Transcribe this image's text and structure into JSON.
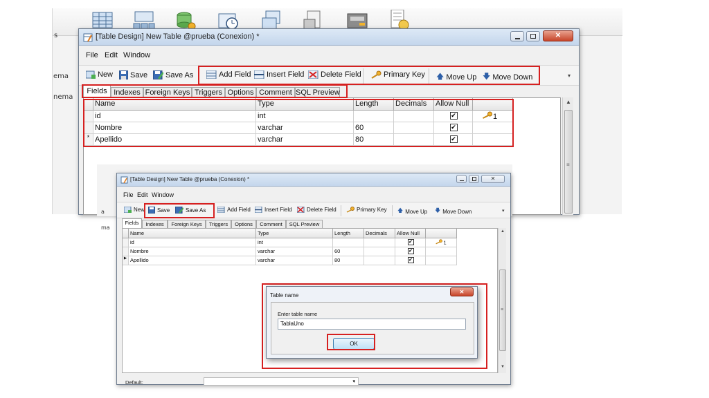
{
  "background": {
    "left_labels": [
      "s",
      "ema",
      "nema"
    ],
    "left_labels_small": [
      "a",
      "ma"
    ]
  },
  "main_window": {
    "title": "[Table Design] New Table @prueba (Conexion) *",
    "menu": {
      "file": "File",
      "edit": "Edit",
      "window": "Window"
    },
    "toolbar": {
      "new": "New",
      "save": "Save",
      "save_as": "Save As",
      "add_field": "Add Field",
      "insert_field": "Insert Field",
      "delete_field": "Delete Field",
      "primary_key": "Primary Key",
      "move_up": "Move Up",
      "move_down": "Move Down"
    },
    "tabs": [
      "Fields",
      "Indexes",
      "Foreign Keys",
      "Triggers",
      "Options",
      "Comment",
      "SQL Preview"
    ],
    "columns": [
      "Name",
      "Type",
      "Length",
      "Decimals",
      "Allow Null",
      ""
    ],
    "rows": [
      {
        "marker": "",
        "name": "id",
        "type": "int",
        "length": "",
        "decimals": "",
        "allow_null": "✔",
        "key": "1"
      },
      {
        "marker": "",
        "name": "Nombre",
        "type": "varchar",
        "length": "60",
        "decimals": "",
        "allow_null": "✔",
        "key": ""
      },
      {
        "marker": "*",
        "name": "Apellido",
        "type": "varchar",
        "length": "80",
        "decimals": "",
        "allow_null": "✔",
        "key": ""
      }
    ]
  },
  "second_window": {
    "title": "[Table Design] New Table @prueba (Conexion) *",
    "menu": {
      "file": "File",
      "edit": "Edit",
      "window": "Window"
    },
    "toolbar": {
      "new": "New",
      "save": "Save",
      "save_as": "Save As",
      "add_field": "Add Field",
      "insert_field": "Insert Field",
      "delete_field": "Delete Field",
      "primary_key": "Primary Key",
      "move_up": "Move Up",
      "move_down": "Move Down"
    },
    "tabs": [
      "Fields",
      "Indexes",
      "Foreign Keys",
      "Triggers",
      "Options",
      "Comment",
      "SQL Preview"
    ],
    "columns": [
      "Name",
      "Type",
      "Length",
      "Decimals",
      "Allow Null",
      ""
    ],
    "rows": [
      {
        "marker": "",
        "name": "id",
        "type": "int",
        "length": "",
        "decimals": "",
        "allow_null": "✔",
        "key": "1"
      },
      {
        "marker": "",
        "name": "Nombre",
        "type": "varchar",
        "length": "60",
        "decimals": "",
        "allow_null": "✔",
        "key": ""
      },
      {
        "marker": "▶",
        "name": "Apellido",
        "type": "varchar",
        "length": "80",
        "decimals": "",
        "allow_null": "✔",
        "key": ""
      }
    ],
    "default_label": "Default:",
    "dialog": {
      "title": "Table name",
      "prompt": "Enter table name",
      "value": "TablaUno",
      "ok": "OK"
    }
  },
  "colors": {
    "highlight": "#d62020",
    "title_bg": "#c4d6ec"
  }
}
